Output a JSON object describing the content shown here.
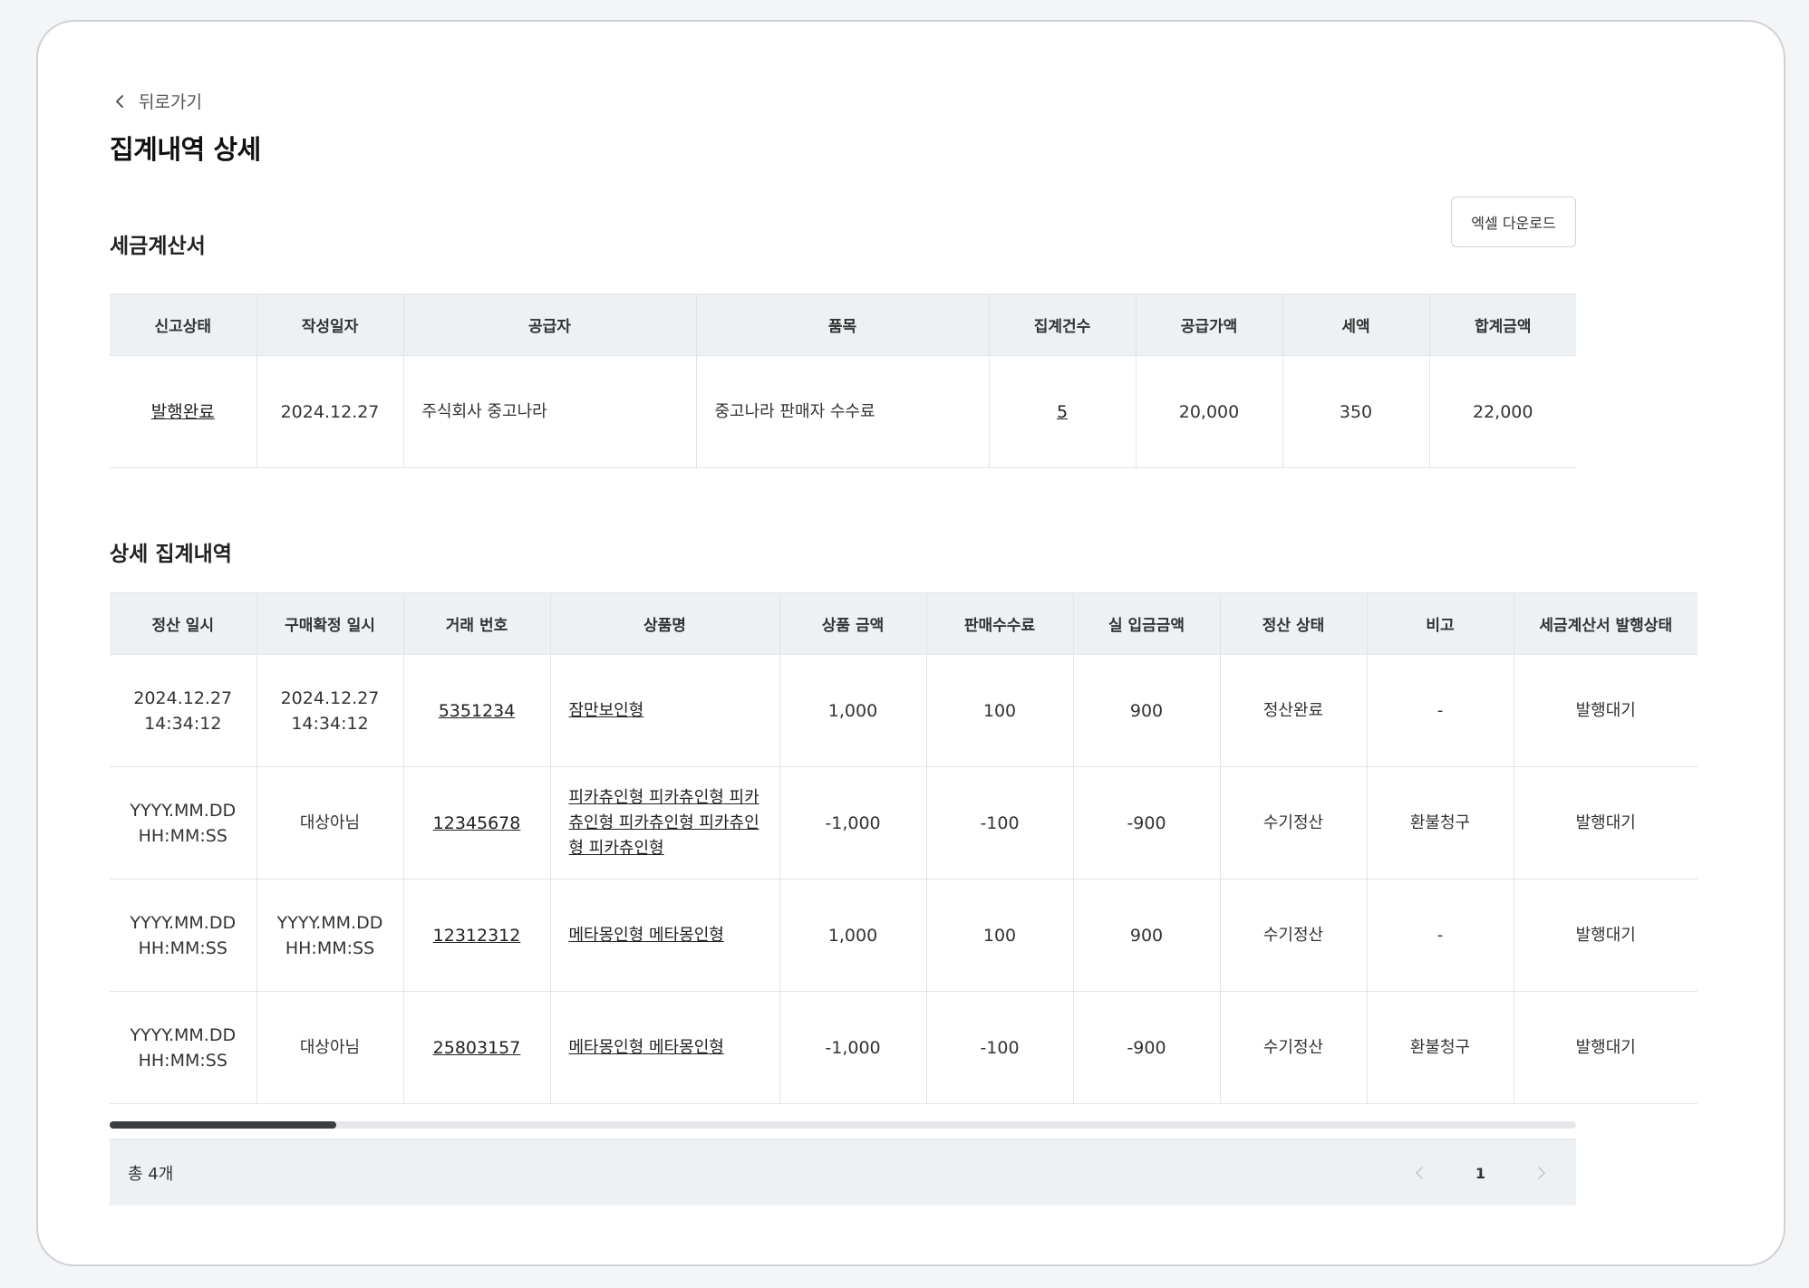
{
  "header": {
    "back_label": "뒤로가기",
    "title": "집계내역 상세"
  },
  "tax_invoice": {
    "section_title": "세금계산서",
    "excel_button": "엑셀 다운로드",
    "columns": [
      "신고상태",
      "작성일자",
      "공급자",
      "품목",
      "집계건수",
      "공급가액",
      "세액",
      "합계금액"
    ],
    "row": {
      "status": "발행완료",
      "date": "2024.12.27",
      "supplier": "주식회사 중고나라",
      "item": "중고나라 판매자 수수료",
      "count": "5",
      "supply_amount": "20,000",
      "tax": "350",
      "total": "22,000"
    }
  },
  "detail": {
    "section_title": "상세 집계내역",
    "columns": [
      "정산 일시",
      "구매확정 일시",
      "거래 번호",
      "상품명",
      "상품 금액",
      "판매수수료",
      "실 입금금액",
      "정산 상태",
      "비고",
      "세금계산서 발행상태"
    ],
    "rows": [
      {
        "settle_date": "2024.12.27",
        "settle_time": "14:34:12",
        "confirm_date": "2024.12.27",
        "confirm_time": "14:34:12",
        "trade_no": "5351234",
        "product": "잠만보인형",
        "price": "1,000",
        "fee": "100",
        "deposit": "900",
        "status": "정산완료",
        "note": "-",
        "invoice_status": "발행대기"
      },
      {
        "settle_date": "YYYY.MM.DD",
        "settle_time": "HH:MM:SS",
        "confirm_date": "대상아님",
        "confirm_time": "",
        "trade_no": "12345678",
        "product": "피카츄인형 피카츄인형 피카츄인형 피카츄인형 피카츄인형 피카츄인형",
        "price": "-1,000",
        "fee": "-100",
        "deposit": "-900",
        "status": "수기정산",
        "note": "환불청구",
        "invoice_status": "발행대기"
      },
      {
        "settle_date": "YYYY.MM.DD",
        "settle_time": "HH:MM:SS",
        "confirm_date": "YYYY.MM.DD",
        "confirm_time": "HH:MM:SS",
        "trade_no": "12312312",
        "product": "메타몽인형 메타몽인형",
        "price": "1,000",
        "fee": "100",
        "deposit": "900",
        "status": "수기정산",
        "note": "-",
        "invoice_status": "발행대기"
      },
      {
        "settle_date": "YYYY.MM.DD",
        "settle_time": "HH:MM:SS",
        "confirm_date": "대상아님",
        "confirm_time": "",
        "trade_no": "25803157",
        "product": "메타몽인형 메타몽인형",
        "price": "-1,000",
        "fee": "-100",
        "deposit": "-900",
        "status": "수기정산",
        "note": "환불청구",
        "invoice_status": "발행대기"
      }
    ]
  },
  "footer": {
    "total_label": "총 4개",
    "current_page": "1"
  },
  "icons": {
    "back": "chevron-left-icon",
    "prev_page": "chevron-left-icon",
    "next_page": "chevron-right-icon"
  }
}
